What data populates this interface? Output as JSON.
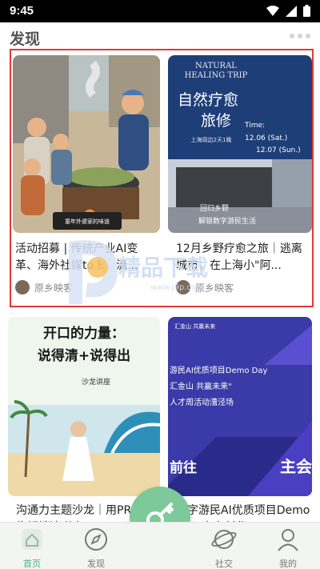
{
  "status_bar": {
    "time": "9:45",
    "icons": [
      "wifi-icon",
      "signal-icon",
      "battery-icon"
    ]
  },
  "header": {
    "title": "发现",
    "menu_icon": "more-icon"
  },
  "cards": [
    {
      "title": "活动招募 | 传统产业AI变革、海外社媒to B、流...",
      "author": "原乡映客",
      "image_text": "童年外婆家的味道"
    },
    {
      "title": "12月乡野疗愈之旅｜逃离城市，在上海小\"阿...",
      "author": "原乡映客",
      "image_text": {
        "en_title_1": "NATURAL",
        "en_title_2": "HEALING TRIP",
        "cn_title_1": "自然疗愈",
        "cn_title_2": "旅修",
        "subtitle": "上海周边2天1晚",
        "time_label": "Time:",
        "date_1": "12.06 (Sat.)",
        "date_2": "12.07 (Sun.)",
        "footer_1": "回归乡野",
        "footer_2": "解锁数字游民生活"
      }
    },
    {
      "title": "沟通力主题沙龙｜用PREP结构解锁清晰表...",
      "image_text": {
        "headline_1": "开口的力量：",
        "headline_2": "说得清+说得出",
        "sub": "沙龙讲座"
      }
    },
    {
      "title": "数字游民AI优质项目Demo Day 大丰创业...",
      "image_text": {
        "top": "汇金山 共赢未来",
        "line_1": "游民AI优质项目Demo Day",
        "line_2": "汇金山 共赢未来\"",
        "line_3": "人才周活动漕泾场",
        "bottom_left": "前往",
        "bottom_right": "主会"
      }
    }
  ],
  "watermark": {
    "text": "精品下载",
    "url": "www.j9p.com"
  },
  "bottom_nav": [
    {
      "label": "首页",
      "icon": "home-icon",
      "active": true
    },
    {
      "label": "发现",
      "icon": "compass-icon",
      "active": false
    },
    {
      "label": "社交",
      "icon": "planet-icon",
      "active": false
    },
    {
      "label": "我的",
      "icon": "user-icon",
      "active": false
    }
  ],
  "fab_icon": "key-icon",
  "colors": {
    "accent": "#4caf80",
    "fab": "#7dc99a",
    "highlight": "#e53935",
    "card_blue": "#1e3e78",
    "card_violet": "#3a3aa8"
  }
}
